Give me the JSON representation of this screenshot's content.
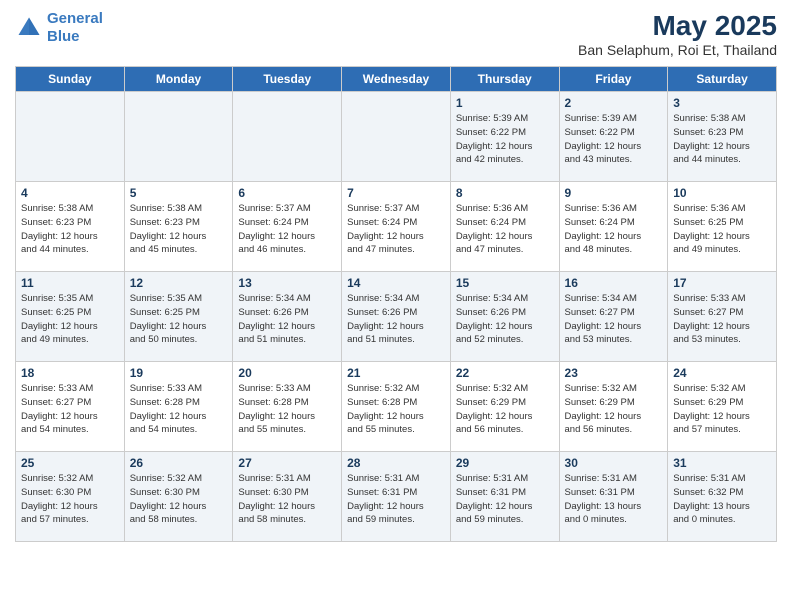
{
  "logo": {
    "line1": "General",
    "line2": "Blue"
  },
  "title": "May 2025",
  "subtitle": "Ban Selaphum, Roi Et, Thailand",
  "days_of_week": [
    "Sunday",
    "Monday",
    "Tuesday",
    "Wednesday",
    "Thursday",
    "Friday",
    "Saturday"
  ],
  "weeks": [
    [
      {
        "num": "",
        "detail": ""
      },
      {
        "num": "",
        "detail": ""
      },
      {
        "num": "",
        "detail": ""
      },
      {
        "num": "",
        "detail": ""
      },
      {
        "num": "1",
        "detail": "Sunrise: 5:39 AM\nSunset: 6:22 PM\nDaylight: 12 hours\nand 42 minutes."
      },
      {
        "num": "2",
        "detail": "Sunrise: 5:39 AM\nSunset: 6:22 PM\nDaylight: 12 hours\nand 43 minutes."
      },
      {
        "num": "3",
        "detail": "Sunrise: 5:38 AM\nSunset: 6:23 PM\nDaylight: 12 hours\nand 44 minutes."
      }
    ],
    [
      {
        "num": "4",
        "detail": "Sunrise: 5:38 AM\nSunset: 6:23 PM\nDaylight: 12 hours\nand 44 minutes."
      },
      {
        "num": "5",
        "detail": "Sunrise: 5:38 AM\nSunset: 6:23 PM\nDaylight: 12 hours\nand 45 minutes."
      },
      {
        "num": "6",
        "detail": "Sunrise: 5:37 AM\nSunset: 6:24 PM\nDaylight: 12 hours\nand 46 minutes."
      },
      {
        "num": "7",
        "detail": "Sunrise: 5:37 AM\nSunset: 6:24 PM\nDaylight: 12 hours\nand 47 minutes."
      },
      {
        "num": "8",
        "detail": "Sunrise: 5:36 AM\nSunset: 6:24 PM\nDaylight: 12 hours\nand 47 minutes."
      },
      {
        "num": "9",
        "detail": "Sunrise: 5:36 AM\nSunset: 6:24 PM\nDaylight: 12 hours\nand 48 minutes."
      },
      {
        "num": "10",
        "detail": "Sunrise: 5:36 AM\nSunset: 6:25 PM\nDaylight: 12 hours\nand 49 minutes."
      }
    ],
    [
      {
        "num": "11",
        "detail": "Sunrise: 5:35 AM\nSunset: 6:25 PM\nDaylight: 12 hours\nand 49 minutes."
      },
      {
        "num": "12",
        "detail": "Sunrise: 5:35 AM\nSunset: 6:25 PM\nDaylight: 12 hours\nand 50 minutes."
      },
      {
        "num": "13",
        "detail": "Sunrise: 5:34 AM\nSunset: 6:26 PM\nDaylight: 12 hours\nand 51 minutes."
      },
      {
        "num": "14",
        "detail": "Sunrise: 5:34 AM\nSunset: 6:26 PM\nDaylight: 12 hours\nand 51 minutes."
      },
      {
        "num": "15",
        "detail": "Sunrise: 5:34 AM\nSunset: 6:26 PM\nDaylight: 12 hours\nand 52 minutes."
      },
      {
        "num": "16",
        "detail": "Sunrise: 5:34 AM\nSunset: 6:27 PM\nDaylight: 12 hours\nand 53 minutes."
      },
      {
        "num": "17",
        "detail": "Sunrise: 5:33 AM\nSunset: 6:27 PM\nDaylight: 12 hours\nand 53 minutes."
      }
    ],
    [
      {
        "num": "18",
        "detail": "Sunrise: 5:33 AM\nSunset: 6:27 PM\nDaylight: 12 hours\nand 54 minutes."
      },
      {
        "num": "19",
        "detail": "Sunrise: 5:33 AM\nSunset: 6:28 PM\nDaylight: 12 hours\nand 54 minutes."
      },
      {
        "num": "20",
        "detail": "Sunrise: 5:33 AM\nSunset: 6:28 PM\nDaylight: 12 hours\nand 55 minutes."
      },
      {
        "num": "21",
        "detail": "Sunrise: 5:32 AM\nSunset: 6:28 PM\nDaylight: 12 hours\nand 55 minutes."
      },
      {
        "num": "22",
        "detail": "Sunrise: 5:32 AM\nSunset: 6:29 PM\nDaylight: 12 hours\nand 56 minutes."
      },
      {
        "num": "23",
        "detail": "Sunrise: 5:32 AM\nSunset: 6:29 PM\nDaylight: 12 hours\nand 56 minutes."
      },
      {
        "num": "24",
        "detail": "Sunrise: 5:32 AM\nSunset: 6:29 PM\nDaylight: 12 hours\nand 57 minutes."
      }
    ],
    [
      {
        "num": "25",
        "detail": "Sunrise: 5:32 AM\nSunset: 6:30 PM\nDaylight: 12 hours\nand 57 minutes."
      },
      {
        "num": "26",
        "detail": "Sunrise: 5:32 AM\nSunset: 6:30 PM\nDaylight: 12 hours\nand 58 minutes."
      },
      {
        "num": "27",
        "detail": "Sunrise: 5:31 AM\nSunset: 6:30 PM\nDaylight: 12 hours\nand 58 minutes."
      },
      {
        "num": "28",
        "detail": "Sunrise: 5:31 AM\nSunset: 6:31 PM\nDaylight: 12 hours\nand 59 minutes."
      },
      {
        "num": "29",
        "detail": "Sunrise: 5:31 AM\nSunset: 6:31 PM\nDaylight: 12 hours\nand 59 minutes."
      },
      {
        "num": "30",
        "detail": "Sunrise: 5:31 AM\nSunset: 6:31 PM\nDaylight: 13 hours\nand 0 minutes."
      },
      {
        "num": "31",
        "detail": "Sunrise: 5:31 AM\nSunset: 6:32 PM\nDaylight: 13 hours\nand 0 minutes."
      }
    ]
  ]
}
